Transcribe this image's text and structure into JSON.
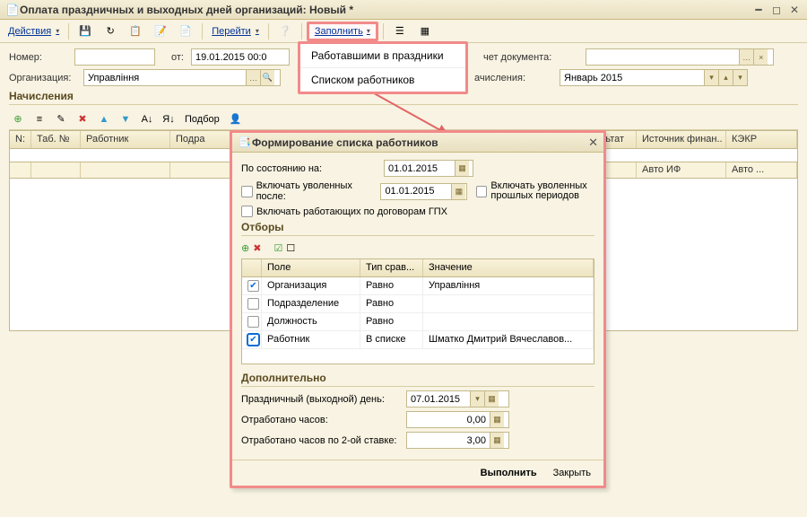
{
  "window": {
    "title": "Оплата праздничных и выходных дней организаций: Новый *"
  },
  "toolbar": {
    "actions": "Действия",
    "goto": "Перейти",
    "fill": "Заполнить",
    "fill_menu": {
      "worked_holidays": "Работавшими в праздники",
      "by_list": "Списком работников"
    }
  },
  "form": {
    "number_label": "Номер:",
    "number_value": "",
    "from_label": "от:",
    "from_value": "19.01.2015 00:0",
    "doc_calc_label": "чет документа:",
    "org_label": "Организация:",
    "org_value": "Управління",
    "accr_month_label": "ачисления:",
    "accr_month_value": "Январь 2015"
  },
  "grid": {
    "section": "Начисления",
    "podbor": "Подбор",
    "cols": {
      "n": "N:",
      "tabn": "Таб. №",
      "worker": "Работник",
      "dept": "Подра",
      "result": "Результат",
      "finsrc": "Источник финан..",
      "kekr": "КЭКР"
    },
    "foot": {
      "auto_if": "Авто ИФ",
      "auto": "Авто ..."
    }
  },
  "modal": {
    "title": "Формирование списка работников",
    "as_of_label": "По состоянию на:",
    "as_of_value": "01.01.2015",
    "include_fired_label": "Включать уволенных после:",
    "include_fired_date": "01.01.2015",
    "include_fired_prev": "Включать уволенных прошлых периодов",
    "include_gph": "Включать работающих по договорам ГПХ",
    "filters_section": "Отборы",
    "fcols": {
      "field": "Поле",
      "cmp": "Тип срав...",
      "value": "Значение"
    },
    "frows": [
      {
        "checked": true,
        "field": "Организация",
        "cmp": "Равно",
        "value": "Управління"
      },
      {
        "checked": false,
        "field": "Подразделение",
        "cmp": "Равно",
        "value": ""
      },
      {
        "checked": false,
        "field": "Должность",
        "cmp": "Равно",
        "value": ""
      },
      {
        "checked": true,
        "field": "Работник",
        "cmp": "В списке",
        "value": "Шматко Дмитрий Вячеславов..."
      }
    ],
    "extra_section": "Дополнительно",
    "holiday_label": "Праздничный (выходной) день:",
    "holiday_value": "07.01.2015",
    "hours_label": "Отработано часов:",
    "hours_value": "0,00",
    "hours2_label": "Отработано часов по 2-ой ставке:",
    "hours2_value": "3,00",
    "execute": "Выполнить",
    "close": "Закрыть"
  }
}
